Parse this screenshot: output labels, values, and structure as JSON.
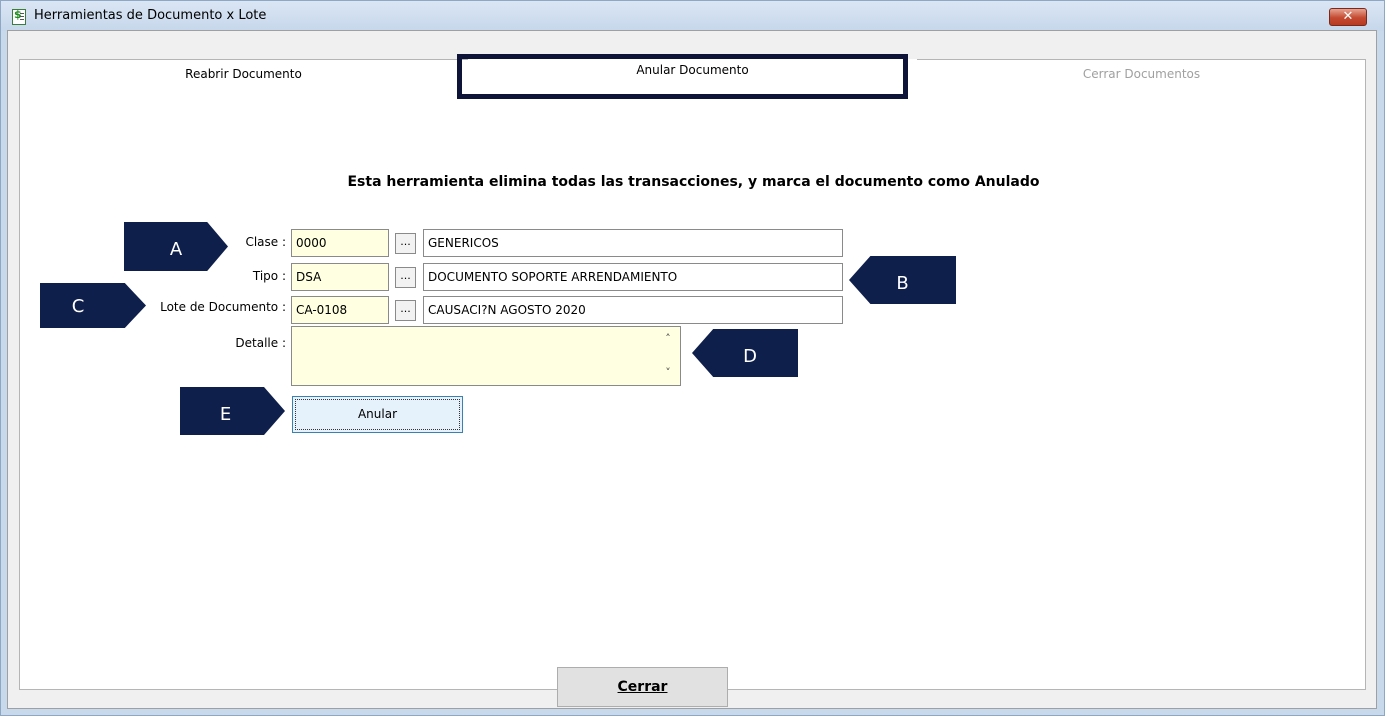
{
  "window": {
    "title": "Herramientas de Documento x Lote",
    "close_glyph": "✕"
  },
  "tabs": [
    {
      "label": "Reabrir Documento"
    },
    {
      "label": "Anular Documento"
    },
    {
      "label": "Cerrar Documentos"
    }
  ],
  "heading": "Esta herramienta elimina todas las transacciones, y marca el documento como Anulado",
  "form": {
    "clase": {
      "label": "Clase :",
      "code": "0000",
      "description": "GENERICOS"
    },
    "tipo": {
      "label": "Tipo :",
      "code": "DSA",
      "description": "DOCUMENTO SOPORTE ARRENDAMIENTO"
    },
    "lote": {
      "label": "Lote de Documento :",
      "code": "CA-0108",
      "description": "CAUSACI?N AGOSTO 2020"
    },
    "detalle": {
      "label": "Detalle :",
      "value": ""
    },
    "ellipsis": "..."
  },
  "buttons": {
    "anular": "Anular",
    "cerrar": "Cerrar"
  },
  "callouts": {
    "a": "A",
    "b": "B",
    "c": "C",
    "d": "D",
    "e": "E"
  },
  "colors": {
    "callout": "#0f1f4b",
    "input_bg": "#ffffe1",
    "active_tab_border": "#0d1438"
  }
}
